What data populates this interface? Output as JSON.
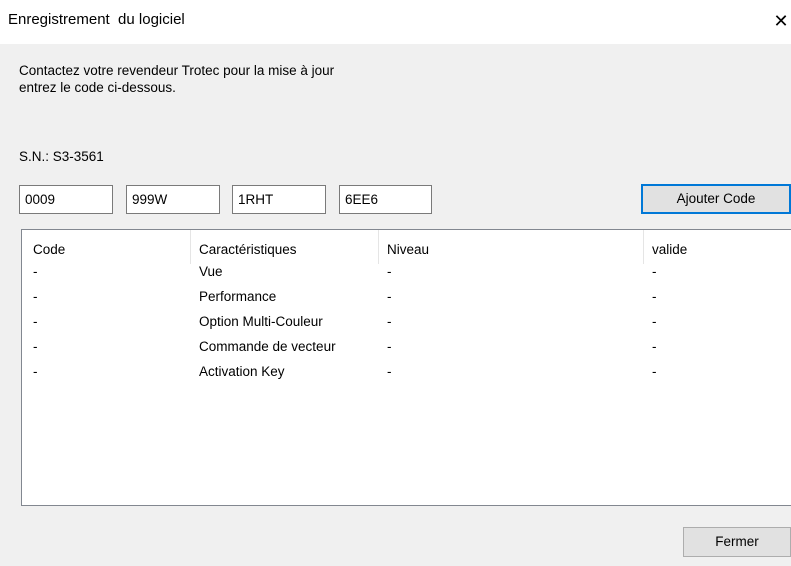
{
  "window": {
    "title": "Enregistrement  du logiciel",
    "close_glyph": "✕"
  },
  "instructions": {
    "line1": "Contactez votre revendeur Trotec pour la mise à jour",
    "line2": "entrez le code ci-dessous."
  },
  "serial": {
    "text": "S.N.: S3-3561"
  },
  "code_fields": [
    "0009",
    "999W",
    "1RHT",
    "6EE6"
  ],
  "buttons": {
    "add_code": "Ajouter Code",
    "close": "Fermer"
  },
  "table": {
    "columns": [
      "Code",
      "Caractéristiques",
      "Niveau",
      "valide"
    ],
    "rows": [
      [
        "-",
        "Vue",
        "-",
        "-"
      ],
      [
        "-",
        "Performance",
        "-",
        "-"
      ],
      [
        "-",
        "Option Multi-Couleur",
        "-",
        "-"
      ],
      [
        "-",
        "Commande de vecteur",
        "-",
        "-"
      ],
      [
        "-",
        "Activation Key",
        "-",
        "-"
      ]
    ]
  },
  "colors": {
    "dialog_bg": "#f0f0f0",
    "titlebar_bg": "#ffffff",
    "focus_accent": "#0078d7"
  }
}
